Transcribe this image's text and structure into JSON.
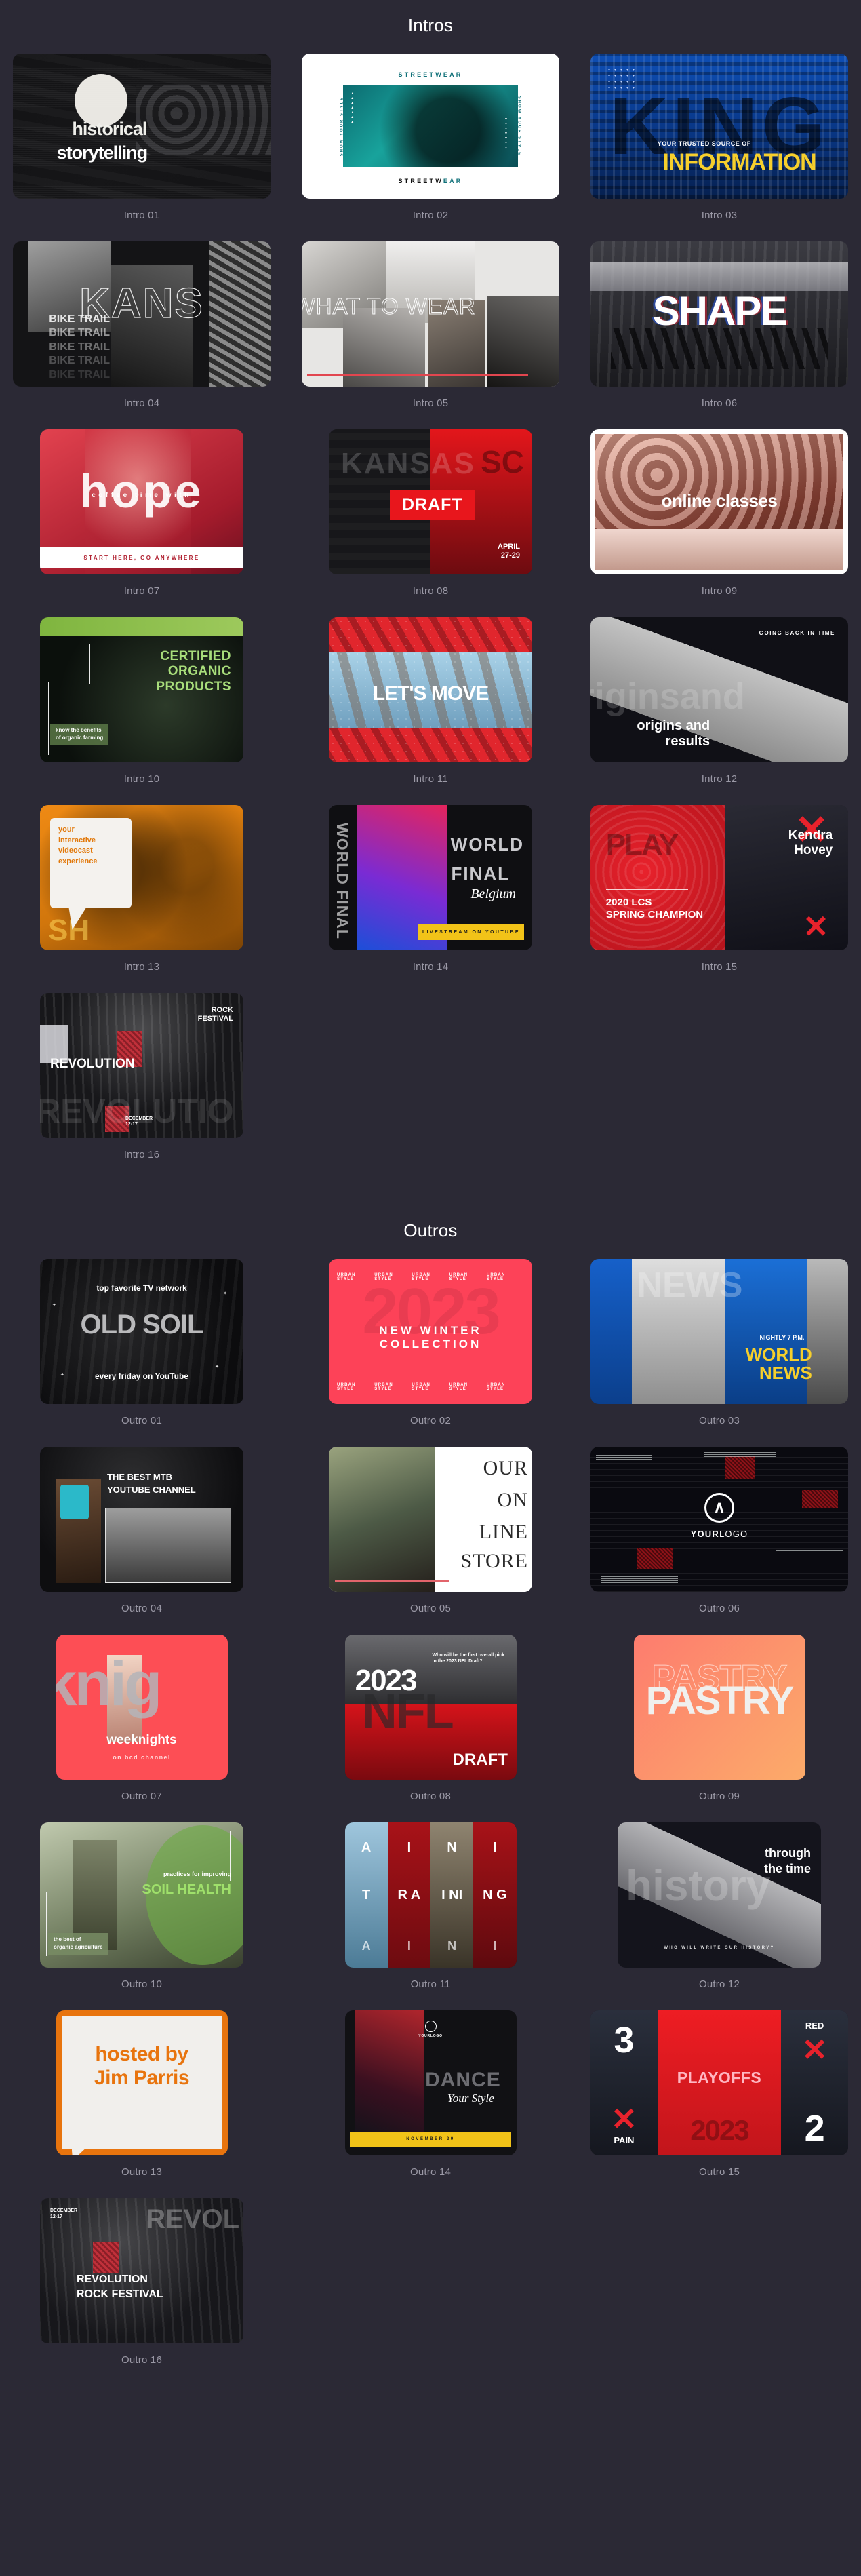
{
  "sections": [
    {
      "id": "intros",
      "title": "Intros",
      "items": [
        {
          "caption": "Intro 01",
          "art": "i01",
          "lines": {
            "t1": "historical",
            "t2": "storytelling"
          }
        },
        {
          "caption": "Intro 02",
          "art": "i02",
          "lines": {
            "top": "STREETWEAR",
            "bot_a": "STREETW",
            "bot_b": "EAR",
            "side": "SHOW YOUR STYLE"
          }
        },
        {
          "caption": "Intro 03",
          "art": "i03",
          "lines": {
            "ghost": "KING",
            "sub": "YOUR TRUSTED SOURCE OF",
            "big": "INFORMATION"
          }
        },
        {
          "caption": "Intro 04",
          "art": "i04",
          "lines": {
            "outline": "KANS",
            "repeat": "BIKE TRAIL"
          }
        },
        {
          "caption": "Intro 05",
          "art": "i05",
          "lines": {
            "txt": "WHAT TO WEAR"
          }
        },
        {
          "caption": "Intro 06",
          "art": "i06",
          "lines": {
            "shape": "SHAPE"
          }
        },
        {
          "caption": "Intro 07",
          "art": "i07",
          "lines": {
            "hope": "hope",
            "sub": "coffee time with",
            "bar": "START HERE, GO ANYWHERE"
          }
        },
        {
          "caption": "Intro 08",
          "art": "i08",
          "lines": {
            "ghost": "KANSAS",
            "ghost2": "SC",
            "badge": "DRAFT",
            "date": "APRIL\n27-29"
          }
        },
        {
          "caption": "Intro 09",
          "art": "i09",
          "lines": {
            "txt": "online classes"
          }
        },
        {
          "caption": "Intro 10",
          "art": "i10",
          "lines": {
            "title": "CERTIFIED\nORGANIC\nPRODUCTS",
            "cap": "know the benefits\nof organic farming"
          }
        },
        {
          "caption": "Intro 11",
          "art": "i11",
          "lines": {
            "txt": "LET'S MOVE"
          }
        },
        {
          "caption": "Intro 12",
          "art": "i12",
          "lines": {
            "hdr": "GOING BACK IN TIME",
            "ghost": "riginsand",
            "tt": "origins and\nresults"
          }
        },
        {
          "caption": "Intro 13",
          "art": "i13",
          "lines": {
            "bubble": "your\ninteractive\nvideocast\nexperience",
            "ghost": "SH"
          }
        },
        {
          "caption": "Intro 14",
          "art": "i14",
          "lines": {
            "side": "WORLD FINAL",
            "t1": "WORLD",
            "t2": "FINAL",
            "t3": "Belgium",
            "bar": "LIVESTREAM ON YOUTUBE"
          }
        },
        {
          "caption": "Intro 15",
          "art": "i15",
          "lines": {
            "play": "PLAY",
            "sub": "2020 LCS\nSPRING CHAMPION",
            "name": "Kendra\nHovey"
          }
        },
        {
          "caption": "Intro 16",
          "art": "i16",
          "lines": {
            "rock": "ROCK\nFESTIVAL",
            "rev": "REVOLUTION",
            "ghost": "REVOLUTIO",
            "date": "DECEMBER\n12-17"
          }
        }
      ]
    },
    {
      "id": "outros",
      "title": "Outros",
      "items": [
        {
          "caption": "Outro 01",
          "art": "o01",
          "lines": {
            "t1": "top favorite TV network",
            "big": "OLD SOIL",
            "t2": "every friday on YouTube"
          }
        },
        {
          "caption": "Outro 02",
          "art": "o02",
          "lines": {
            "year": "2023",
            "main": "NEW WINTER COLLECTION",
            "tag": "URBAN STYLE"
          }
        },
        {
          "caption": "Outro 03",
          "art": "o03",
          "lines": {
            "ghost": "NEWS",
            "n1": "NIGHTLY 7 P.M.",
            "n2": "WORLD\nNEWS"
          }
        },
        {
          "caption": "Outro 04",
          "art": "o04",
          "lines": {
            "t": "THE BEST MTB\nYOUTUBE CHANNEL"
          }
        },
        {
          "caption": "Outro 05",
          "art": "o05",
          "lines": {
            "w1": "OUR",
            "w2": "ON",
            "w3": "LINE",
            "w4": "STORE"
          }
        },
        {
          "caption": "Outro 06",
          "art": "o06",
          "lines": {
            "logo_a": "YOUR",
            "logo_b": "LOGO"
          }
        },
        {
          "caption": "Outro 07",
          "art": "o07",
          "lines": {
            "ghost": "knig",
            "t1": "weeknights",
            "t2": "on bcd channel"
          }
        },
        {
          "caption": "Outro 08",
          "art": "o08",
          "lines": {
            "yr": "2023",
            "nfl": "NFL",
            "q": "Who will be the first overall pick in the 2023 NFL Draft?",
            "dr": "DRAFT"
          }
        },
        {
          "caption": "Outro 09",
          "art": "o09",
          "lines": {
            "outline": "PASTRY",
            "fill": "PASTRY"
          }
        },
        {
          "caption": "Outro 10",
          "art": "o10",
          "lines": {
            "t1": "practices for improving",
            "t2": "SOIL HEALTH",
            "cap": "the best of\norganic agriculture"
          }
        },
        {
          "caption": "Outro 11",
          "art": "o11",
          "lines": {
            "top": "A I N I",
            "mid": "T R A I NI N G",
            "bot": "A I N I"
          }
        },
        {
          "caption": "Outro 12",
          "art": "o12",
          "lines": {
            "ghost": "history",
            "t1": "through\nthe time",
            "t2": "WHO WILL WRITE OUR HISTORY?"
          }
        },
        {
          "caption": "Outro 13",
          "art": "o13",
          "lines": {
            "t": "hosted by\nJim Parris"
          }
        },
        {
          "caption": "Outro 14",
          "art": "o14",
          "lines": {
            "logo": "YOURLOGO",
            "d1": "DANCE",
            "d2": "Your Style",
            "bar": "NOVEMBER 29"
          }
        },
        {
          "caption": "Outro 15",
          "art": "o15",
          "lines": {
            "numL": "3",
            "lblL": "PAIN",
            "po": "PLAYOFFS",
            "yr": "2023",
            "lblR": "RED",
            "numR": "2"
          }
        },
        {
          "caption": "Outro 16",
          "art": "o16",
          "lines": {
            "ghost": "REVOL",
            "date": "DECEMBER\n12-17",
            "t1": "REVOLUTION",
            "t2": "ROCK FESTIVAL"
          }
        }
      ]
    }
  ]
}
